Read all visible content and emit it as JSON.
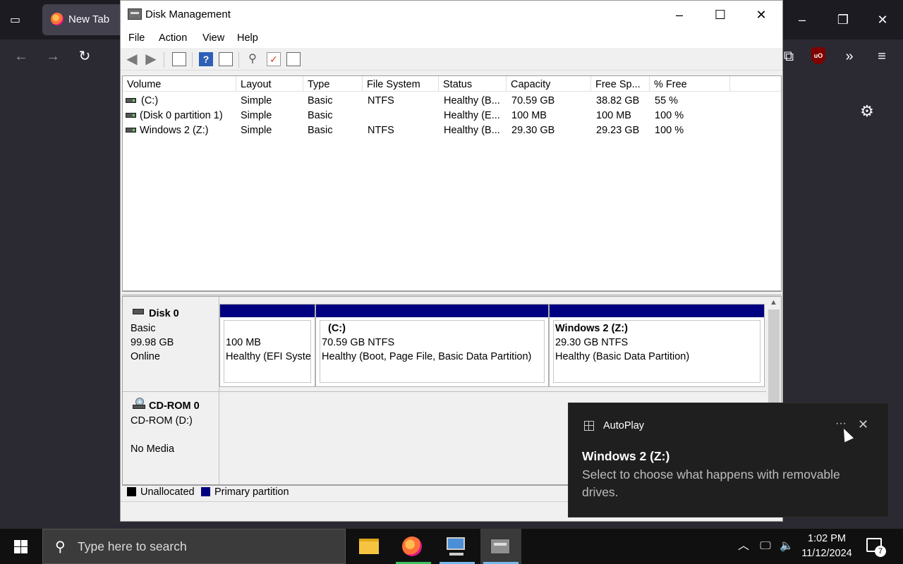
{
  "browser": {
    "tab_title": "New Tab"
  },
  "window": {
    "title": "Disk Management",
    "menu": [
      "File",
      "Action",
      "View",
      "Help"
    ]
  },
  "volume_table": {
    "columns": [
      "Volume",
      "Layout",
      "Type",
      "File System",
      "Status",
      "Capacity",
      "Free Sp...",
      "% Free"
    ],
    "rows": [
      [
        "(C:)",
        "Simple",
        "Basic",
        "NTFS",
        "Healthy (B...",
        "70.59 GB",
        "38.82 GB",
        "55 %"
      ],
      [
        "(Disk 0 partition 1)",
        "Simple",
        "Basic",
        "",
        "Healthy (E...",
        "100 MB",
        "100 MB",
        "100 %"
      ],
      [
        "Windows 2 (Z:)",
        "Simple",
        "Basic",
        "NTFS",
        "Healthy (B...",
        "29.30 GB",
        "29.23 GB",
        "100 %"
      ]
    ]
  },
  "disks": [
    {
      "name": "Disk 0",
      "type": "Basic",
      "size": "99.98 GB",
      "state": "Online",
      "partitions": [
        {
          "label": "",
          "size": "100 MB",
          "status": "Healthy (EFI Syste"
        },
        {
          "label": "(C:)",
          "size": "70.59 GB NTFS",
          "status": "Healthy (Boot, Page File, Basic Data Partition)"
        },
        {
          "label": "Windows 2  (Z:)",
          "size": "29.30 GB NTFS",
          "status": "Healthy (Basic Data Partition)"
        }
      ]
    },
    {
      "name": "CD-ROM 0",
      "type": "CD-ROM (D:)",
      "media": "No Media"
    }
  ],
  "legend": {
    "unallocated": "Unallocated",
    "primary": "Primary partition",
    "unallocated_color": "#000000",
    "primary_color": "#000080"
  },
  "toast": {
    "app": "AutoPlay",
    "heading": "Windows 2 (Z:)",
    "body": "Select to choose what happens with removable drives."
  },
  "taskbar": {
    "search_placeholder": "Type here to search",
    "time": "1:02 PM",
    "date": "11/12/2024",
    "notification_count": "7"
  }
}
